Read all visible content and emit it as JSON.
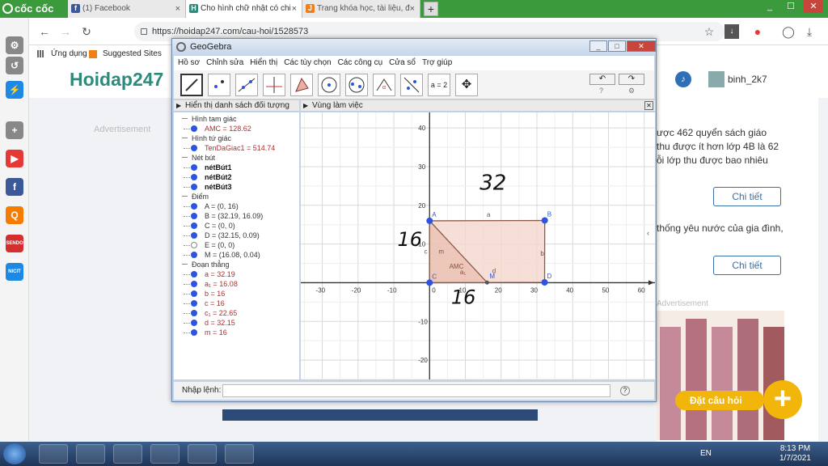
{
  "browser": {
    "brand": "cốc cốc",
    "tabs": [
      {
        "title": "(1) Facebook",
        "icon": "f",
        "color": "#3b5998"
      },
      {
        "title": "Cho hình chữ nhật có chi",
        "icon": "H",
        "color": "#2f8a7b"
      },
      {
        "title": "Trang khóa học, tài liệu, đ",
        "icon": "J",
        "color": "#f07f1a"
      }
    ],
    "new_tab": "+",
    "url": "https://hoidap247.com/cau-hoi/1528573",
    "bookmarks": [
      "Ứng dụng",
      "Suggested Sites"
    ],
    "win_controls": [
      "_",
      "☐",
      "✕"
    ]
  },
  "sidebar": [
    {
      "name": "settings-icon",
      "glyph": "⚙",
      "color": "#888"
    },
    {
      "name": "history-icon",
      "glyph": "↺",
      "color": "#888"
    },
    {
      "name": "messenger-icon",
      "glyph": "⚡",
      "color": "#1e88e5"
    },
    {
      "name": "add-icon",
      "glyph": "+",
      "color": "#888"
    },
    {
      "name": "youtube-icon",
      "glyph": "▶",
      "color": "#e53935"
    },
    {
      "name": "facebook-icon",
      "glyph": "f",
      "color": "#3b5998"
    },
    {
      "name": "search-icon",
      "glyph": "Q",
      "color": "#f57c00"
    },
    {
      "name": "sendo-icon",
      "glyph": "SENDO -50%",
      "color": "#d32f2f"
    },
    {
      "name": "nict-icon",
      "glyph": "NICIT",
      "color": "#1e88e5"
    }
  ],
  "page": {
    "logo": "Hoidap247",
    "advertisement": "Advertisement",
    "advertisement2": "Advertisement",
    "user": "binh_2k7",
    "question_lines": [
      "ược 462 quyển sách giáo",
      "thu được ít hơn lớp 4B là 62",
      "ỗi lớp thu được bao nhiêu"
    ],
    "chi_tiet": "Chi tiết",
    "second_line": "thống yêu nước của gia đình,",
    "chi_tiet2": "Chi tiết",
    "dat_cau_hoi": "Đặt câu hỏi",
    "plus": "+"
  },
  "geogebra": {
    "title": "GeoGebra",
    "menu": [
      "Hồ sơ",
      "Chỉnh sửa",
      "Hiển thị",
      "Các tùy chọn",
      "Các công cụ",
      "Cửa sổ",
      "Trợ giúp"
    ],
    "tool_label": "a = 2",
    "algebra_header": "Hiển thị danh sách đối tượng",
    "graphics_header": "Vùng làm việc",
    "command_label": "Nhập lệnh:",
    "algebra": [
      {
        "type": "cat",
        "text": "Hình tam giác"
      },
      {
        "type": "item",
        "text": "AMC = 128.62",
        "style": "red"
      },
      {
        "type": "cat",
        "text": "Hình tứ giác"
      },
      {
        "type": "item",
        "text": "TenDaGiac1 = 514.74",
        "style": "red"
      },
      {
        "type": "cat",
        "text": "Nét bút"
      },
      {
        "type": "item",
        "text": "nétBút1",
        "style": "blk"
      },
      {
        "type": "item",
        "text": "nétBút2",
        "style": "blk"
      },
      {
        "type": "item",
        "text": "nétBút3",
        "style": "blk"
      },
      {
        "type": "cat",
        "text": "Điểm"
      },
      {
        "type": "item",
        "text": "A = (0, 16)",
        "style": "blue"
      },
      {
        "type": "item",
        "text": "B = (32.19, 16.09)",
        "style": "blue"
      },
      {
        "type": "item",
        "text": "C = (0, 0)",
        "style": "blue"
      },
      {
        "type": "item",
        "text": "D = (32.15, 0.09)",
        "style": "blue"
      },
      {
        "type": "item",
        "text": "E = (0, 0)",
        "style": "hollow"
      },
      {
        "type": "item",
        "text": "M = (16.08, 0.04)",
        "style": "blue"
      },
      {
        "type": "cat",
        "text": "Đoạn thẳng"
      },
      {
        "type": "item",
        "text": "a = 32.19",
        "style": "red"
      },
      {
        "type": "item",
        "text": "a₁ = 16.08",
        "style": "red"
      },
      {
        "type": "item",
        "text": "b = 16",
        "style": "red"
      },
      {
        "type": "item",
        "text": "c = 16",
        "style": "red"
      },
      {
        "type": "item",
        "text": "c₁ = 22.65",
        "style": "red"
      },
      {
        "type": "item",
        "text": "d = 32.15",
        "style": "red"
      },
      {
        "type": "item",
        "text": "m = 16",
        "style": "red"
      }
    ],
    "axes": {
      "x_ticks": [
        -30,
        -20,
        -10,
        0,
        10,
        20,
        30,
        40,
        50,
        60
      ],
      "y_ticks": [
        40,
        30,
        20,
        10,
        0,
        -10,
        -20
      ],
      "xlim": [
        -36,
        63
      ],
      "ylim": [
        -25,
        44
      ]
    },
    "points": [
      {
        "label": "A",
        "x": 0,
        "y": 16
      },
      {
        "label": "B",
        "x": 32.19,
        "y": 16.09
      },
      {
        "label": "C",
        "x": 0,
        "y": 0
      },
      {
        "label": "D",
        "x": 32.15,
        "y": 0.09
      },
      {
        "label": "M",
        "x": 16.08,
        "y": 0.04
      }
    ],
    "segment_labels": [
      "a",
      "b",
      "d",
      "m",
      "c",
      "a₁",
      "AMC"
    ],
    "handwritten": [
      "32",
      "16",
      "16"
    ]
  },
  "taskbar": {
    "lang": "EN",
    "time": "8:13 PM",
    "date": "1/7/2021"
  },
  "colors": {
    "accent": "#3a9a3c",
    "ggb_fill": "#f2d7cd",
    "ggb_stroke": "#8a5a4a",
    "point": "#2d54e0",
    "brand": "#2f8a7b",
    "cta": "#f2b60a"
  }
}
